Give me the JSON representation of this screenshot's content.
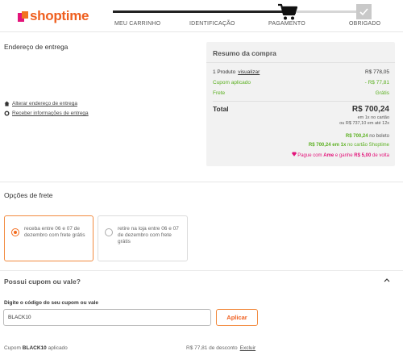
{
  "header": {
    "logo": "shoptime",
    "steps": [
      "MEU CARRINHO",
      "IDENTIFICAÇÃO",
      "PAGAMENTO",
      "OBRIGADO"
    ],
    "active_step_icon": "cart-icon",
    "done_step_icon": "check-icon"
  },
  "delivery": {
    "title": "Endereço de entrega",
    "change_address_link": "Alterar endereço de entrega",
    "receive_info_link": "Receber informações de entrega"
  },
  "summary": {
    "title": "Resumo da compra",
    "products_label": "1 Produto",
    "view_link": "visualizar",
    "products_value": "R$ 778,05",
    "coupon_label": "Cupom aplicado",
    "coupon_value": "- R$ 77,81",
    "shipping_label": "Frete",
    "shipping_value": "Grátis",
    "total_label": "Total",
    "total_value": "R$ 700,24",
    "total_sub1": "em 1x no cartão",
    "total_sub2": "ou R$ 737,10 em até 12x",
    "boleto_value": "R$ 700,24",
    "boleto_text": "no boleto",
    "card_value": "R$ 700,24 em 1x",
    "card_text": "no cartão Shoptime",
    "ame_prefix": "Pague com",
    "ame_brand": "Ame",
    "ame_middle": "e ganhe",
    "ame_value": "R$ 5,00",
    "ame_suffix": "de volta",
    "accent_green": "#5bb020",
    "accent_pink": "#e3147a"
  },
  "freight": {
    "title": "Opções de frete",
    "options": [
      {
        "text": "receba entre 06 e 07 de dezembro com frete grátis",
        "selected": true
      },
      {
        "text": "retire na loja entre 06 e 07 de dezembro com frete grátis",
        "selected": false
      }
    ]
  },
  "coupon": {
    "question": "Possui cupom ou vale?",
    "input_label": "Digite o código do seu cupom ou vale",
    "input_value": "BLACK10",
    "apply_label": "Aplicar",
    "applied_prefix": "Cupom",
    "applied_code": "BLACK10",
    "applied_suffix": "aplicado",
    "discount_text": "R$ 77,81 de desconto",
    "remove_link": "Excluir"
  },
  "colors": {
    "brand_orange": "#ef5f1f",
    "brand_pink": "#e3147a"
  }
}
